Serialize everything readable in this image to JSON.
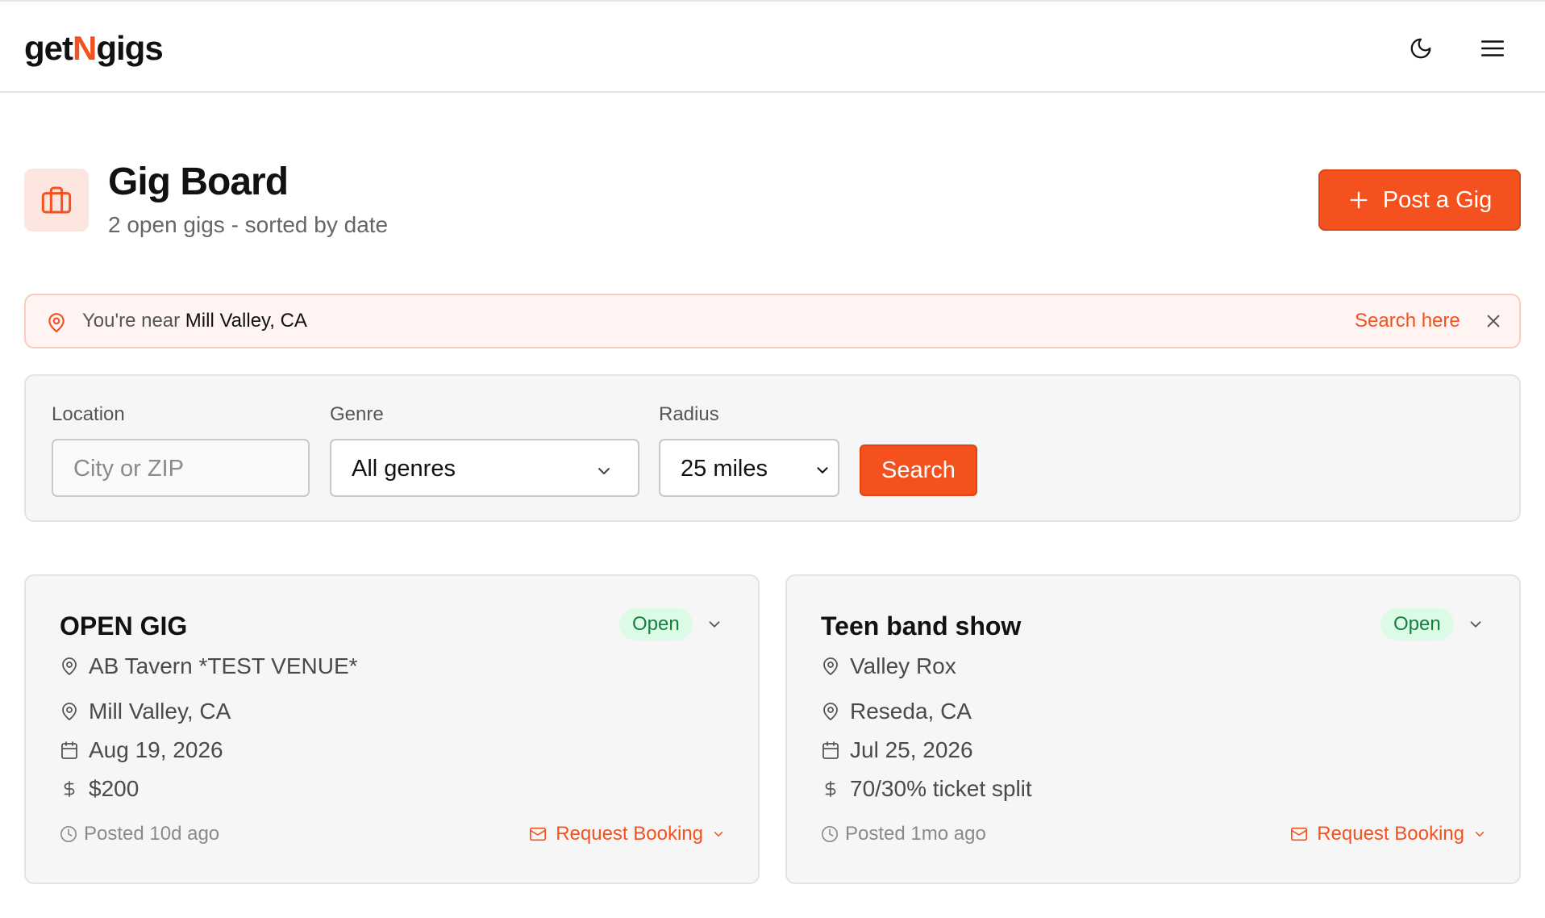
{
  "header": {
    "logo_pre": "get",
    "logo_accent": "N",
    "logo_post": "gigs",
    "theme_icon": "moon-icon",
    "menu_icon": "hamburger-menu-icon"
  },
  "page": {
    "icon": "briefcase-icon",
    "title": "Gig Board",
    "subtitle": "2 open gigs - sorted by date",
    "post_button": "Post a Gig"
  },
  "banner": {
    "prefix": "You're near ",
    "location": "Mill Valley, CA",
    "action": "Search here"
  },
  "filters": {
    "location_label": "Location",
    "location_placeholder": "City or ZIP",
    "location_value": "",
    "genre_label": "Genre",
    "genre_value": "All genres",
    "radius_label": "Radius",
    "radius_value": "25 miles",
    "search_button": "Search"
  },
  "gigs": [
    {
      "title": "OPEN GIG",
      "status": "Open",
      "venue": "AB Tavern *TEST VENUE*",
      "city": "Mill Valley, CA",
      "date": "Aug 19, 2026",
      "pay": "$200",
      "posted": "Posted 10d ago",
      "action": "Request Booking"
    },
    {
      "title": "Teen band show",
      "status": "Open",
      "venue": "Valley Rox",
      "city": "Reseda, CA",
      "date": "Jul 25, 2026",
      "pay": "70/30% ticket split",
      "posted": "Posted 1mo ago",
      "action": "Request Booking"
    }
  ],
  "colors": {
    "accent": "#f4511e",
    "status_bg": "#dcfbe6",
    "status_text": "#15803d"
  }
}
